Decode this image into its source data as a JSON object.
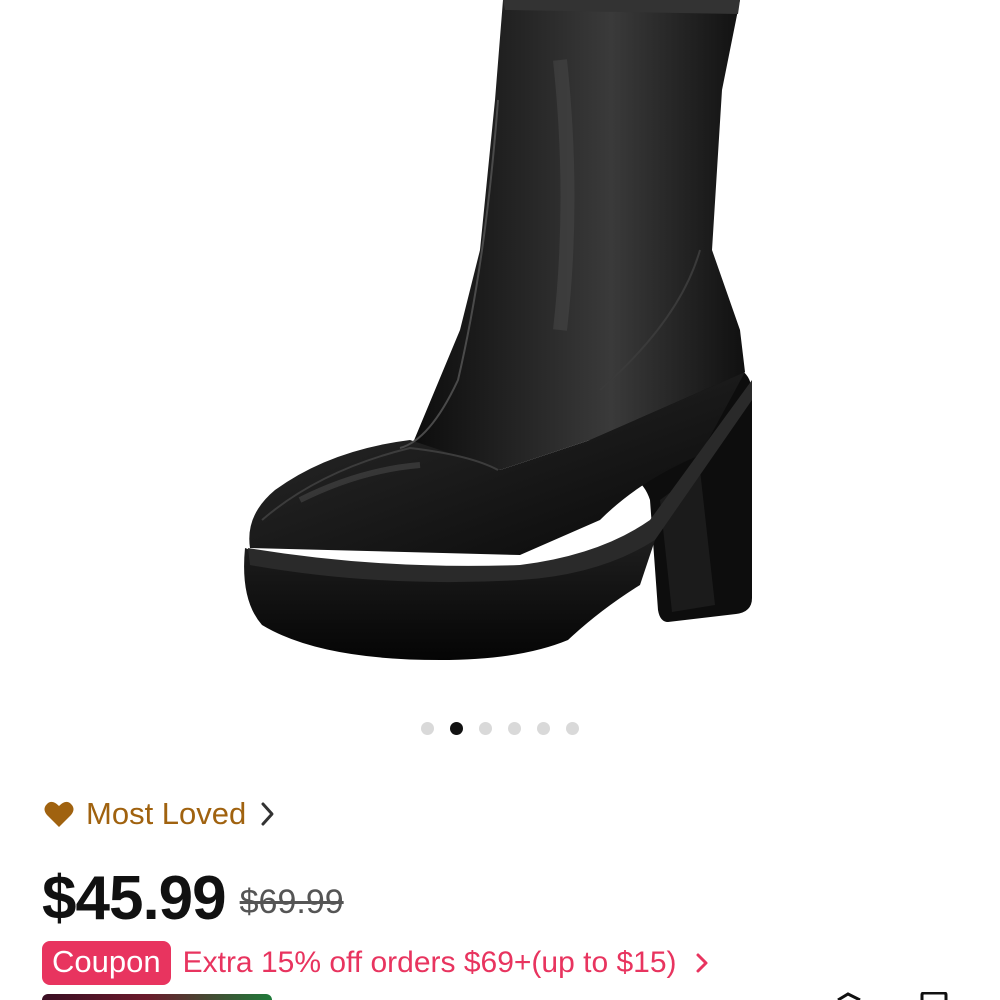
{
  "gallery": {
    "image_icon": "black-platform-boot-image",
    "dot_count": 6,
    "active_index": 1
  },
  "badge": {
    "icon": "heart-icon",
    "label": "Most Loved",
    "color": "#a0620f"
  },
  "pricing": {
    "price": "$45.99",
    "original_price": "$69.99"
  },
  "coupon": {
    "tag": "Coupon",
    "text": "Extra 15% off orders $69+(up to $15)",
    "color": "#e8345f"
  }
}
